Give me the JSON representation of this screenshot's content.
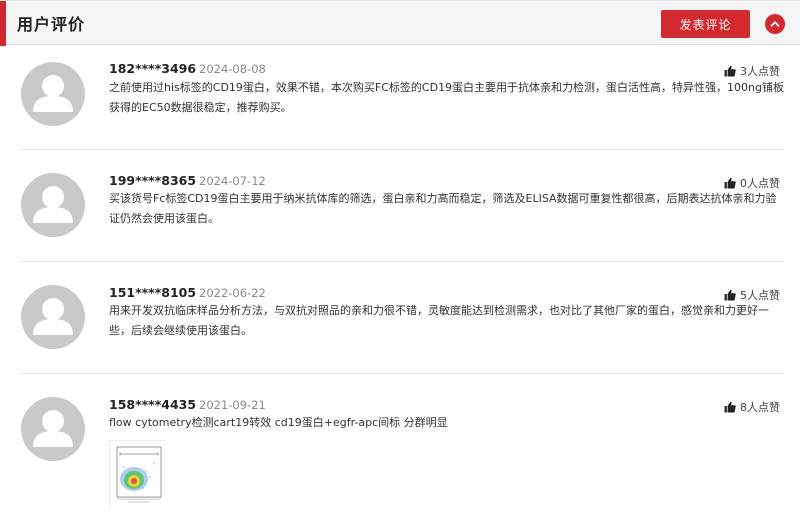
{
  "header": {
    "title": "用户评价",
    "post_button": "发表评论",
    "collapse_icon": "chevron-up-icon",
    "accent_color": "#d32a30"
  },
  "reviews": [
    {
      "user": "182****3496",
      "date": "2024-08-08",
      "likes": "3人点赞",
      "content": "之前使用过his标签的CD19蛋白，效果不错，本次购买FC标签的CD19蛋白主要用于抗体亲和力检测，蛋白活性高，特异性强，100ng铺板获得的EC50数据很稳定，推荐购买。"
    },
    {
      "user": "199****8365",
      "date": "2024-07-12",
      "likes": "0人点赞",
      "content": "买该货号Fc标签CD19蛋白主要用于纳米抗体库的筛选，蛋白亲和力高而稳定，筛选及ELISA数据可重复性都很高，后期表达抗体亲和力验证仍然会使用该蛋白。"
    },
    {
      "user": "151****8105",
      "date": "2022-06-22",
      "likes": "5人点赞",
      "content": "用来开发双抗临床样品分析方法，与双抗对照品的亲和力很不错，灵敏度能达到检测需求，也对比了其他厂家的蛋白，感觉亲和力更好一些，后续会继续使用该蛋白。"
    },
    {
      "user": "158****4435",
      "date": "2021-09-21",
      "likes": "8人点赞",
      "content": "flow cytometry检测cart19转效 cd19蛋白+egfr-apc间标 分群明显",
      "image": "flow-cytometry-thumbnail"
    }
  ]
}
